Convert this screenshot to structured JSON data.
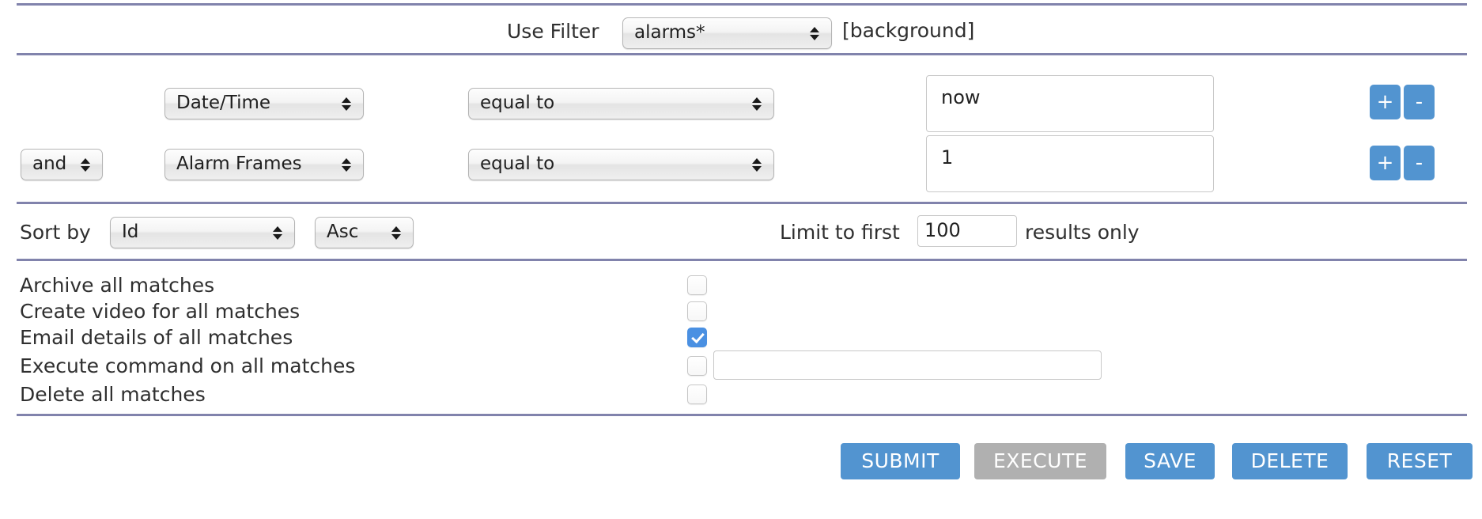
{
  "filter_bar": {
    "use_filter_label": "Use Filter",
    "filter_select_value": "alarms*",
    "background_tag": "[background]"
  },
  "conditions": [
    {
      "conjunction": null,
      "field": "Date/Time",
      "operator": "equal to",
      "value": "now",
      "add_label": "+",
      "remove_label": "-"
    },
    {
      "conjunction": "and",
      "field": "Alarm Frames",
      "operator": "equal to",
      "value": "1",
      "add_label": "+",
      "remove_label": "-"
    }
  ],
  "sort_row": {
    "sort_by_label": "Sort by",
    "sort_field": "Id",
    "sort_direction": "Asc",
    "limit_prefix": "Limit to first",
    "limit_value": "100",
    "limit_suffix": "results only"
  },
  "actions": [
    {
      "label": "Archive all matches",
      "checked": false
    },
    {
      "label": "Create video for all matches",
      "checked": false
    },
    {
      "label": "Email details of all matches",
      "checked": true
    },
    {
      "label": "Execute command on all matches",
      "checked": false,
      "command_value": ""
    },
    {
      "label": "Delete all matches",
      "checked": false
    }
  ],
  "buttons": {
    "submit": "SUBMIT",
    "execute": "EXECUTE",
    "save": "SAVE",
    "delete": "DELETE",
    "reset": "RESET"
  },
  "colors": {
    "rule": "#8183ac",
    "accent_blue": "#5294d0",
    "checked_blue": "#4a90e2",
    "disabled_gray": "#b0b0b0"
  }
}
